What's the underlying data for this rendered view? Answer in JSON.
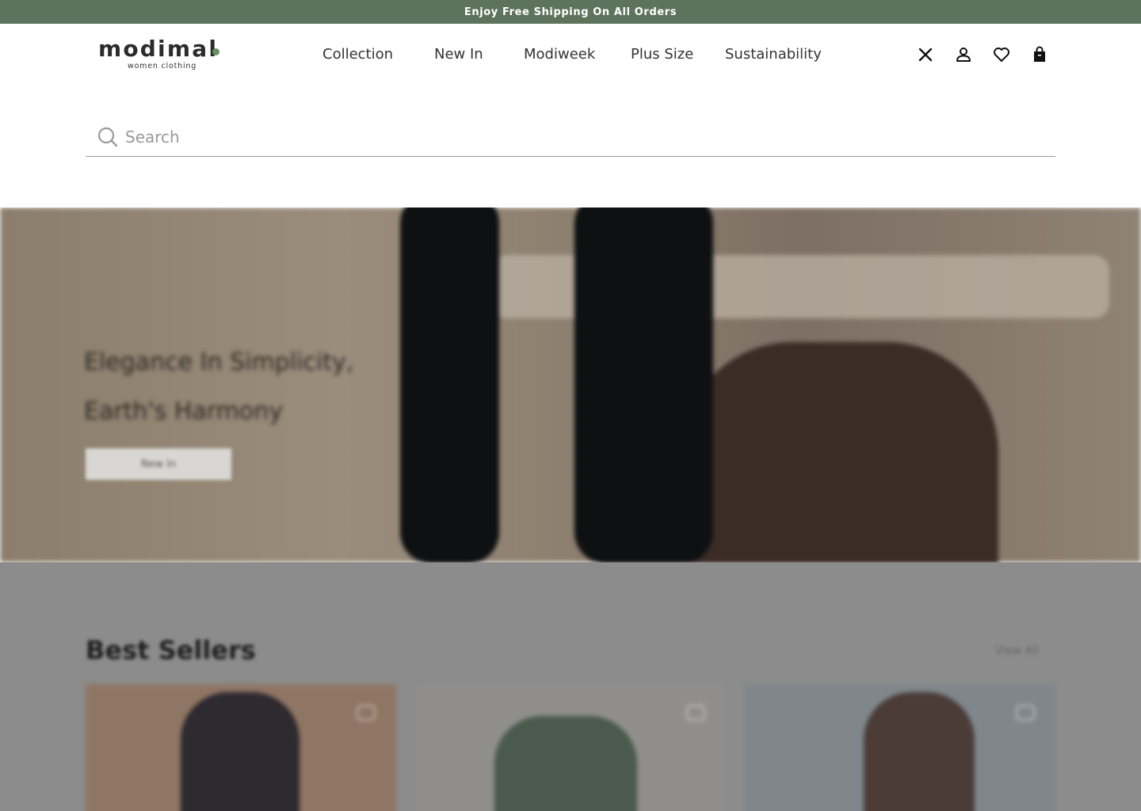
{
  "announcement": "Enjoy Free Shipping On All Orders",
  "brand": {
    "name": "modimal",
    "tagline": "women clothing"
  },
  "nav": [
    {
      "label": "Collection"
    },
    {
      "label": "New In"
    },
    {
      "label": "Modiweek"
    },
    {
      "label": "Plus Size"
    },
    {
      "label": "Sustainability"
    }
  ],
  "icons": [
    "close-icon",
    "user-icon",
    "heart-icon",
    "shopping-bag-icon"
  ],
  "search": {
    "placeholder": "Search",
    "value": ""
  },
  "colors": {
    "announcement_bg": "#5e735c",
    "accent_green": "#6b8f5e",
    "overlay": "#8c8c8c"
  },
  "background_page": {
    "hero": {
      "title_line1": "Elegance In Simplicity,",
      "title_line2": "Earth's Harmony",
      "button": "New In"
    },
    "best_sellers": {
      "title": "Best Sellers",
      "view_all": "View All"
    }
  }
}
